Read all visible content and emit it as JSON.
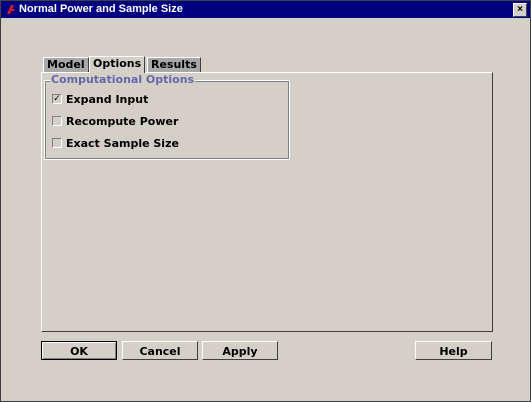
{
  "window": {
    "title": "Normal Power and Sample Size",
    "close_glyph": "×"
  },
  "tabs": [
    {
      "label": "Model",
      "active": false
    },
    {
      "label": "Options",
      "active": true
    },
    {
      "label": "Results",
      "active": false
    }
  ],
  "group": {
    "legend": "Computational Options",
    "options": [
      {
        "label": "Expand Input",
        "checked": true,
        "check_glyph": "✓"
      },
      {
        "label": "Recompute Power",
        "checked": false,
        "check_glyph": ""
      },
      {
        "label": "Exact Sample Size",
        "checked": false,
        "check_glyph": ""
      }
    ]
  },
  "buttons": {
    "ok": "OK",
    "cancel": "Cancel",
    "apply": "Apply",
    "help": "Help"
  },
  "colors": {
    "titlebar": "#000080",
    "legend_text": "#6666aa",
    "face": "#d4d0c8",
    "inactive_tab": "#a8a8a8"
  },
  "icons": {
    "app": "app-logo-icon",
    "close": "close-icon",
    "check": "checkmark-icon"
  }
}
